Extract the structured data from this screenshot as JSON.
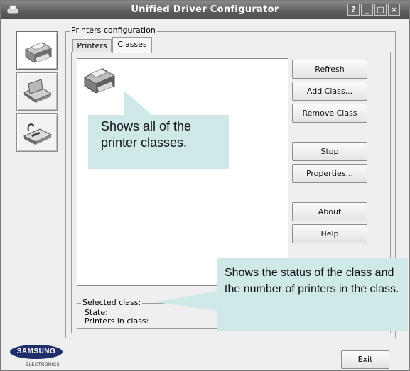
{
  "window": {
    "title": "Unified Driver Configurator",
    "controls": [
      "?",
      "_",
      "□",
      "×"
    ]
  },
  "sidebar": {
    "items": [
      {
        "name": "printers",
        "icon": "printer-icon",
        "active": true
      },
      {
        "name": "scanners",
        "icon": "scanner-icon",
        "active": false
      },
      {
        "name": "ports",
        "icon": "port-icon",
        "active": false
      }
    ]
  },
  "main": {
    "group_label": "Printers configuration",
    "tabs": [
      {
        "label": "Printers",
        "active": false
      },
      {
        "label": "Classes",
        "active": true
      }
    ],
    "buttons": {
      "refresh": "Refresh",
      "add_class": "Add Class...",
      "remove_class": "Remove Class",
      "stop": "Stop",
      "properties": "Properties...",
      "about": "About",
      "help": "Help"
    },
    "selected_class": {
      "legend": "Selected class:",
      "state": "State:",
      "printers_in_class": "Printers in class:"
    }
  },
  "callouts": {
    "list": "Shows all of the printer classes.",
    "status": "Shows the status of the class and the number of printers in the class."
  },
  "footer": {
    "logo": "SAMSUNG",
    "logo_sub": "ELECTRONICS",
    "exit": "Exit"
  },
  "colors": {
    "titlebar": "#5c5c5c",
    "callout": "#cfe9e9",
    "window_bg": "#efefef"
  }
}
